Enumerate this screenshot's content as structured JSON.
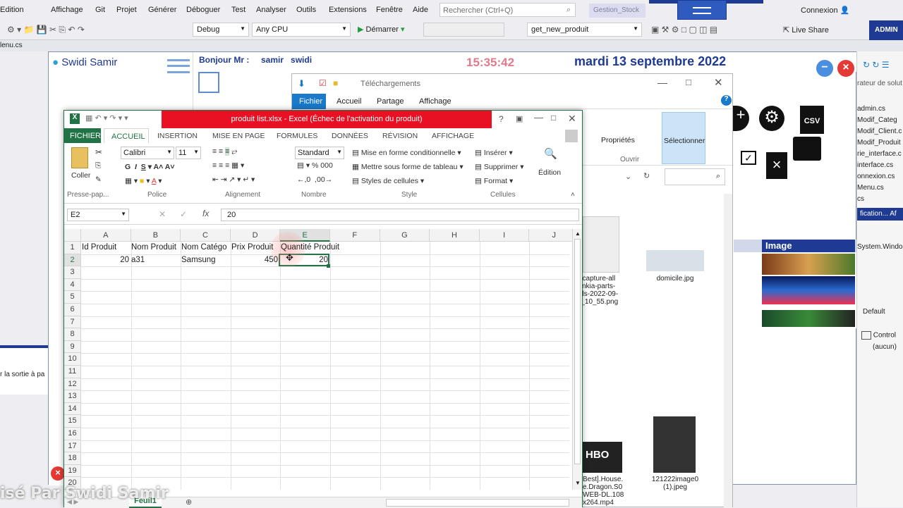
{
  "vs": {
    "menu": [
      "Edition",
      "Affichage",
      "Git",
      "Projet",
      "Générer",
      "Déboguer",
      "Test",
      "Analyser",
      "Outils",
      "Extensions",
      "Fenêtre",
      "Aide"
    ],
    "search_placeholder": "Rechercher (Ctrl+Q)",
    "solution_name": "Gestion_Stock",
    "account": "Connexion",
    "config": "Debug",
    "platform": "Any CPU",
    "start": "Démarrer",
    "method": "get_new_produit",
    "live_share": "Live Share",
    "admin": "ADMIN",
    "doc_tab": "lenu.cs",
    "output_text": "r la sortie à pa",
    "right_files": [
      "rateur de solut",
      "admin.cs",
      "Modif_Categ",
      "Modif_Client.c",
      "Modif_Produit",
      "rie_interface.c",
      "interface.cs",
      "onnexion.cs",
      "Menu.cs",
      "cs"
    ],
    "props_header": "fication...",
    "props_header2": "Af",
    "props_value": "System.Windo",
    "props_default": "Default",
    "props_control": "Control",
    "props_aucun": "(aucun)",
    "image_col": "Image"
  },
  "app": {
    "logo": "Swidi Samir",
    "greeting": "Bonjour Mr :",
    "user_first": "samir",
    "user_last": "swidi",
    "time": "15:35:42",
    "date": "mardi 13 septembre 2022"
  },
  "explorer": {
    "title": "Téléchargements",
    "tabs": [
      "Fichier",
      "Accueil",
      "Partage",
      "Affichage"
    ],
    "ribbon": {
      "properties": "Propriétés",
      "open_group": "Ouvrir",
      "select": "Sélectionner"
    },
    "files": [
      {
        "name": "ncapture-all\nvnkia-parts-\nals-2022-09-\n)_10_55.png"
      },
      {
        "name": "domicile.jpg"
      },
      {
        "name": "Best].House.\ne.Dragon.S0\nWEB-DL.108\nx264.mp4"
      },
      {
        "name": "121222image0\n(1).jpeg"
      }
    ]
  },
  "excel": {
    "title": "produit list.xlsx -  Excel (Échec de l'activation du produit)",
    "tabs": [
      "FICHIER",
      "ACCUEIL",
      "INSERTION",
      "MISE EN PAGE",
      "FORMULES",
      "DONNÉES",
      "RÉVISION",
      "AFFICHAGE"
    ],
    "font": "Calibri",
    "size": "11",
    "number_format": "Standard",
    "paste": "Coller",
    "ribbon_items": {
      "cond_format": "Mise en forme conditionnelle",
      "table_format": "Mettre sous forme de tableau",
      "cell_styles": "Styles de cellules",
      "insert": "Insérer",
      "delete": "Supprimer",
      "format": "Format",
      "edition": "Édition"
    },
    "groups": [
      "Presse-pap...",
      "Police",
      "Alignement",
      "Nombre",
      "Style",
      "Cellules"
    ],
    "name_box": "E2",
    "formula": "20",
    "columns": [
      "A",
      "B",
      "C",
      "D",
      "E",
      "F",
      "G",
      "H",
      "I",
      "J"
    ],
    "rows": [
      "1",
      "2",
      "3",
      "4",
      "5",
      "6",
      "7",
      "8",
      "9",
      "10",
      "11",
      "12",
      "13",
      "14",
      "15",
      "16",
      "17",
      "18",
      "19",
      "20"
    ],
    "headers": [
      "Id Produit",
      "Nom Produit",
      "Nom Catégo",
      "Prix Produit",
      "Quantité Produit"
    ],
    "row2": {
      "a": "20",
      "b": "a31",
      "c": "Samsung",
      "d": "450",
      "e": "20"
    },
    "sheet": "Feuil1"
  },
  "watermark": "isé Par Swidi Samir"
}
